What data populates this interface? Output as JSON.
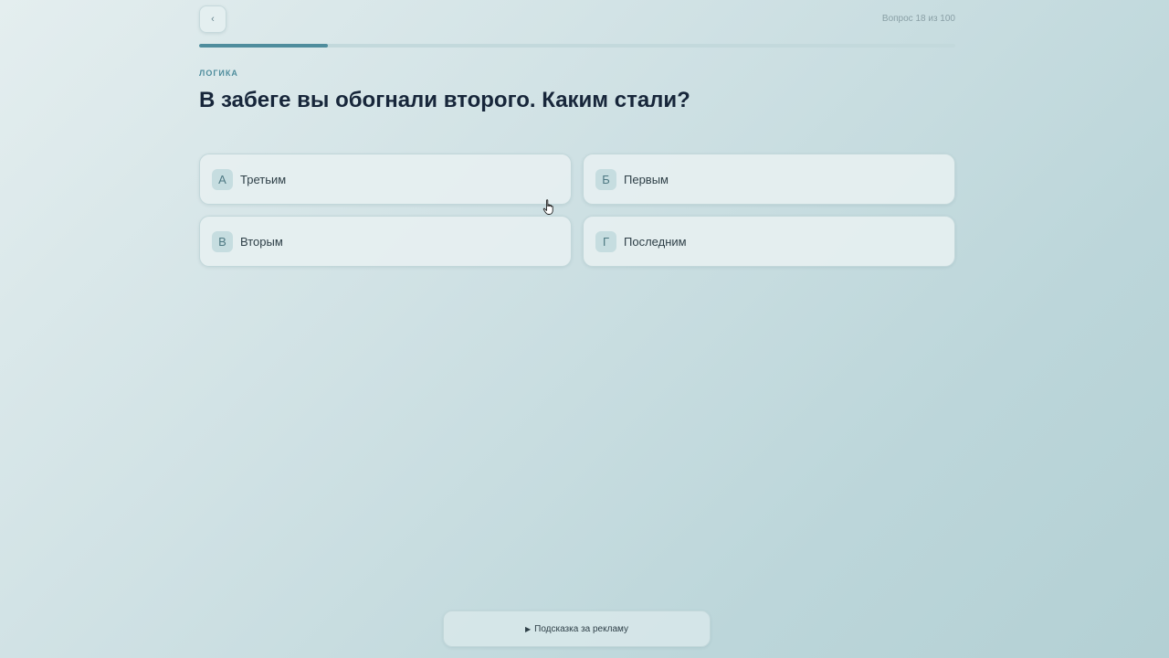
{
  "header": {
    "back_label": "‹",
    "counter": "Вопрос 18 из 100"
  },
  "progress": {
    "current": 18,
    "total": 100,
    "fraction": 0.17
  },
  "quiz": {
    "category": "ЛОГИКА",
    "question": "В забеге вы обогнали второго. Каким стали?",
    "options": [
      {
        "letter": "А",
        "label": "Третьим"
      },
      {
        "letter": "Б",
        "label": "Первым"
      },
      {
        "letter": "В",
        "label": "Вторым"
      },
      {
        "letter": "Г",
        "label": "Последним"
      }
    ]
  },
  "footer": {
    "hint_label": "Подсказка за рекламу"
  },
  "colors": {
    "accent": "#4f8d9d",
    "title": "#17263a"
  }
}
